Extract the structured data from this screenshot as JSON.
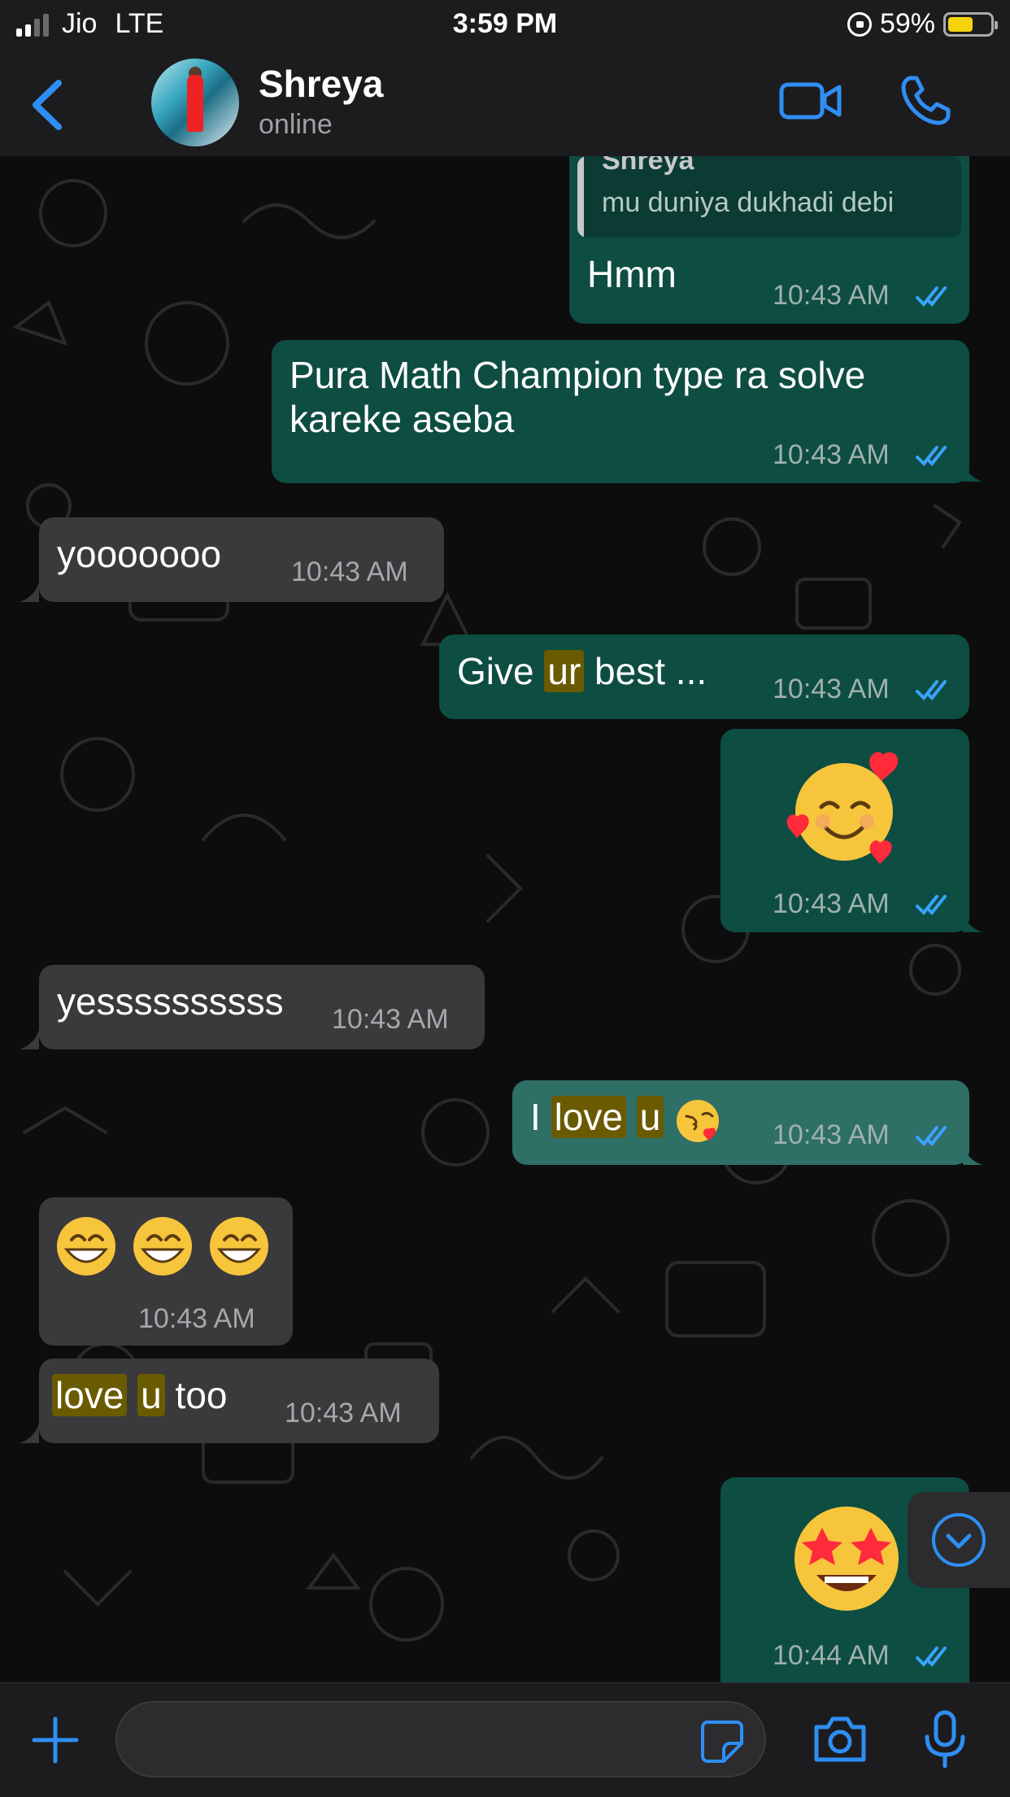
{
  "status_bar": {
    "carrier": "Jio",
    "network": "LTE",
    "time": "3:59 PM",
    "battery": "59%",
    "battery_level": 0.59
  },
  "header": {
    "contact_name": "Shreya",
    "status": "online",
    "icons": [
      "back-chevron-icon",
      "video-call-icon",
      "phone-call-icon"
    ]
  },
  "messages": [
    {
      "dir": "out",
      "reply": {
        "author": "Shreya",
        "text": "mu duniya dukhadi debi"
      },
      "text": "Hmm",
      "time": "10:43 AM"
    },
    {
      "dir": "out",
      "lines": [
        "Pura Math Champion type ra solve",
        "kareke aseba"
      ],
      "time": "10:43 AM"
    },
    {
      "dir": "in",
      "text": "yooooooo",
      "time": "10:43 AM"
    },
    {
      "dir": "out",
      "parts": [
        "Give ",
        "ur",
        " best ..."
      ],
      "time": "10:43 AM"
    },
    {
      "dir": "out",
      "emoji": "smiling-face-with-hearts",
      "time": "10:43 AM"
    },
    {
      "dir": "in",
      "text": "yessssssssss",
      "time": "10:43 AM"
    },
    {
      "dir": "out",
      "parts": [
        "I ",
        "love",
        " ",
        "u"
      ],
      "emoji": "face-blowing-kiss",
      "time": "10:43 AM"
    },
    {
      "dir": "in",
      "emoji": "grinning-face x3",
      "time": "10:43 AM"
    },
    {
      "dir": "in",
      "parts": [
        "love",
        " ",
        "u",
        " too"
      ],
      "time": "10:43 AM"
    },
    {
      "dir": "out",
      "emoji": "star-struck",
      "time": "10:44 AM"
    }
  ],
  "composer": {
    "placeholder": "",
    "icons": [
      "plus-icon",
      "sticker-icon",
      "camera-icon",
      "microphone-icon"
    ]
  },
  "colors": {
    "outgoing_bubble": "#0e4d42",
    "incoming_bubble": "#3a3a3c",
    "accent": "#2f8ef4",
    "highlight": "#6a5a00"
  }
}
